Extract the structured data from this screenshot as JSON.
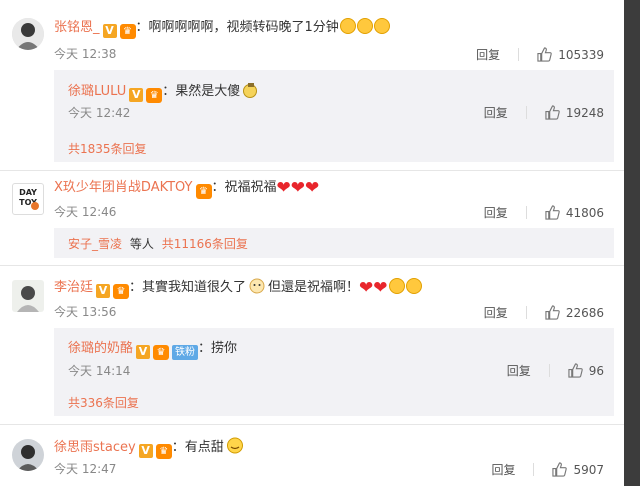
{
  "comments": [
    {
      "username": "张铭恩_",
      "text": "：啊啊啊啊啊，视频转码晚了1分钟",
      "time": "今天 12:38",
      "reply_label": "回复",
      "likes": "105339",
      "sub": {
        "username": "徐璐LULU",
        "text": "：果然是大傻",
        "time": "今天 12:42",
        "reply_label": "回复",
        "likes": "19248",
        "more": "共1835条回复"
      }
    },
    {
      "username": "X玖少年团肖战DAKTOY",
      "text": "：祝福祝福",
      "time": "今天 12:46",
      "reply_label": "回复",
      "likes": "41806",
      "avatar_text": "DAY TOY",
      "sub_line": {
        "user": "安子_雪凌",
        "middle": "等人",
        "total": "共11166条回复"
      }
    },
    {
      "username": "李治廷",
      "text": "：其實我知道很久了",
      "text2": "但還是祝福啊！",
      "time": "今天 13:56",
      "reply_label": "回复",
      "likes": "22686",
      "sub": {
        "username": "徐璐的奶酪",
        "tie_badge": "铁粉",
        "text": "：捞你",
        "time": "今天 14:14",
        "reply_label": "回复",
        "likes": "96",
        "more": "共336条回复"
      }
    },
    {
      "username": "徐思雨stacey",
      "text": "：有点甜",
      "time": "今天 12:47",
      "reply_label": "回复",
      "likes": "5907"
    }
  ],
  "badges": {
    "v": "V",
    "fan": "♛"
  },
  "colors": {
    "accent": "#eb7350",
    "reply_bg": "#f2f2f5",
    "heart": "#e8262c"
  }
}
